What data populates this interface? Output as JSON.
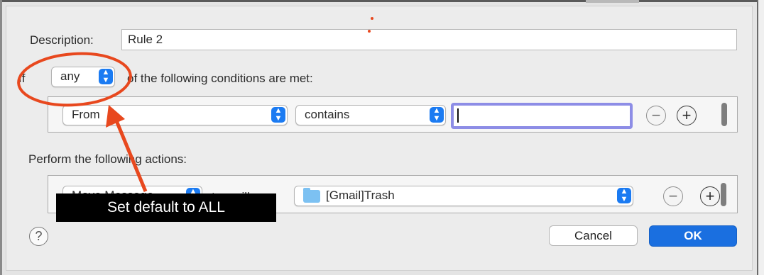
{
  "description": {
    "label": "Description:",
    "value": "Rule 2"
  },
  "conditions": {
    "prefix": "If",
    "match_value": "any",
    "suffix": "of the following conditions are met:",
    "field": "From",
    "operator": "contains",
    "value": ""
  },
  "actions": {
    "heading": "Perform the following actions:",
    "action_value": "Move Message",
    "to_mailbox_label": "to mailbox:",
    "mailbox_value": "[Gmail]Trash"
  },
  "buttons": {
    "cancel": "Cancel",
    "ok": "OK",
    "help": "?"
  },
  "annotation": {
    "callout_text": "Set default to ALL",
    "color": "#e8481e"
  },
  "colors": {
    "accent": "#1a6fe0",
    "focus_ring": "#8d8de6"
  },
  "icons": {
    "stepper": "up-down-chevron-icon",
    "remove": "minus-circle-icon",
    "add": "plus-circle-icon",
    "folder": "folder-icon"
  }
}
